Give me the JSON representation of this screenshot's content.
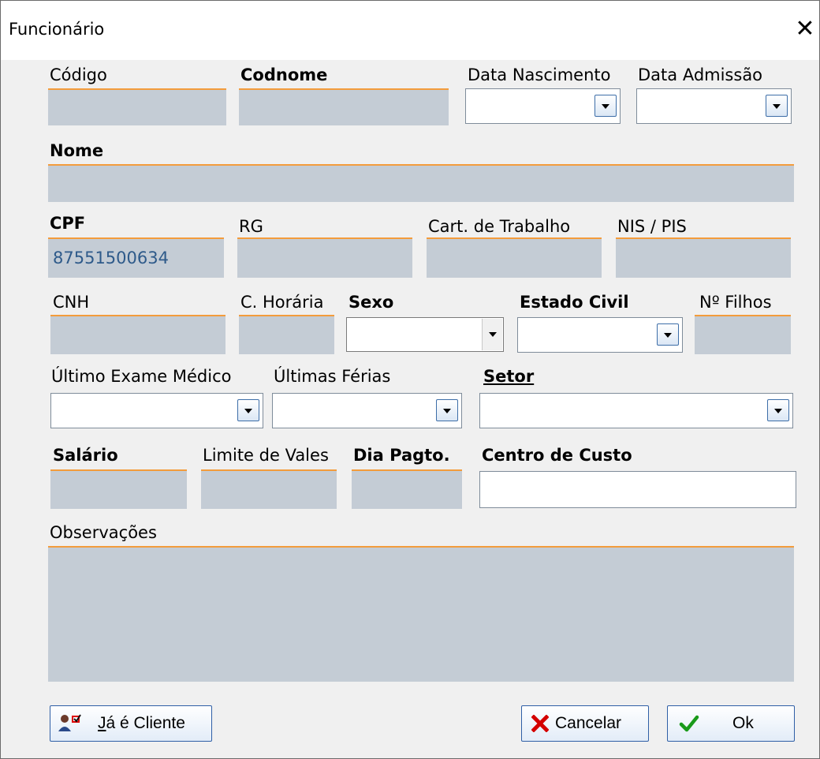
{
  "window": {
    "title": "Funcionário",
    "close_glyph": "✕"
  },
  "labels": {
    "codigo": "Código",
    "codnome": "Codnome",
    "data_nascimento": "Data Nascimento",
    "data_admissao": "Data Admissão",
    "nome": "Nome",
    "cpf": "CPF",
    "rg": "RG",
    "cart_trabalho": "Cart. de Trabalho",
    "nis_pis": "NIS / PIS",
    "cnh": "CNH",
    "c_horaria": "C. Horária",
    "sexo": "Sexo",
    "estado_civil": "Estado Civil",
    "n_filhos": "Nº Filhos",
    "ultimo_exame": "Último Exame Médico",
    "ultimas_ferias": "Últimas Férias",
    "setor": "Setor",
    "salario": "Salário",
    "limite_vales": "Limite de Vales",
    "dia_pagto": "Dia Pagto.",
    "centro_custo": "Centro de Custo",
    "observacoes": "Observações"
  },
  "values": {
    "codigo": "",
    "codnome": "",
    "data_nascimento": "",
    "data_admissao": "",
    "nome": "",
    "cpf": "87551500634",
    "rg": "",
    "cart_trabalho": "",
    "nis_pis": "",
    "cnh": "",
    "c_horaria": "",
    "sexo": "",
    "estado_civil": "",
    "n_filhos": "",
    "ultimo_exame": "",
    "ultimas_ferias": "",
    "setor": "",
    "salario": "",
    "limite_vales": "",
    "dia_pagto": "",
    "centro_custo": "",
    "observacoes": ""
  },
  "buttons": {
    "ja_cliente": {
      "mnemonic": "J",
      "rest": "á é Cliente",
      "icon": "user-check-icon"
    },
    "cancelar": {
      "label": "Cancelar",
      "icon": "x-icon"
    },
    "ok": {
      "label": "Ok",
      "icon": "checkmark-icon"
    }
  },
  "colors": {
    "accent_underline": "#f39c3c",
    "readonly_field": "#c4ccd5",
    "value_text": "#2e5a8a",
    "cancel_icon": "#d40000",
    "ok_icon": "#1a9a1a"
  }
}
